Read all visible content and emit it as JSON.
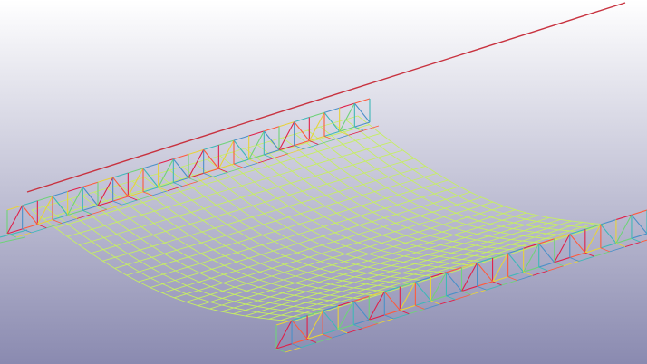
{
  "viewport": {
    "background_top": "#ffffff",
    "background_bottom": "#8a8ab0"
  },
  "model": {
    "mesh_color": "#c6ee62",
    "cable_color": "#c8323f",
    "truss_colors": [
      "#e0204a",
      "#ff5a3c",
      "#e8d23a",
      "#3fb8b8",
      "#6fd27a",
      "#4a90c8"
    ]
  }
}
